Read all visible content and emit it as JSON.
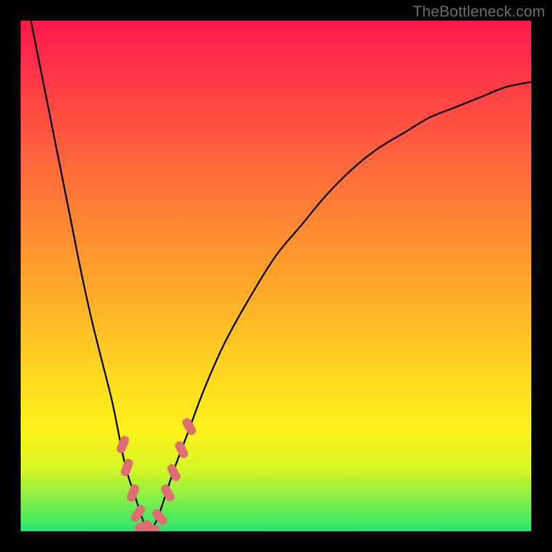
{
  "watermark": "TheBottleneck.com",
  "colors": {
    "frame": "#000000",
    "gradient_top": "#ff1a4b",
    "gradient_bottom": "#2be36e",
    "curve": "#000000",
    "marker_fill": "#de6e72",
    "marker_stroke": "#c85c63"
  },
  "chart_data": {
    "type": "line",
    "title": "",
    "xlabel": "",
    "ylabel": "",
    "xlim": [
      0,
      100
    ],
    "ylim": [
      0,
      100
    ],
    "grid": false,
    "series": [
      {
        "name": "curve",
        "x": [
          2,
          4,
          6,
          8,
          10,
          12,
          14,
          16,
          18,
          20,
          21,
          22,
          23,
          24,
          25,
          26,
          27,
          28,
          30,
          33,
          36,
          40,
          45,
          50,
          55,
          60,
          65,
          70,
          75,
          80,
          85,
          90,
          95,
          100
        ],
        "y": [
          100,
          90,
          80,
          70,
          60,
          50,
          41,
          33,
          25,
          15,
          11,
          8,
          5,
          2,
          0,
          1,
          3,
          6,
          12,
          20,
          28,
          37,
          46,
          54,
          60,
          66,
          71,
          75,
          78,
          81,
          83,
          85,
          87,
          88
        ]
      }
    ],
    "markers": [
      {
        "x": 20.0,
        "y": 17.0,
        "shape": "pill",
        "angle": -68
      },
      {
        "x": 20.8,
        "y": 12.5,
        "shape": "pill",
        "angle": -70
      },
      {
        "x": 22.0,
        "y": 7.5,
        "shape": "pill",
        "angle": -70
      },
      {
        "x": 23.0,
        "y": 3.5,
        "shape": "pill",
        "angle": -55
      },
      {
        "x": 24.0,
        "y": 1.0,
        "shape": "pill",
        "angle": -20
      },
      {
        "x": 25.5,
        "y": 0.5,
        "shape": "pill",
        "angle": 10
      },
      {
        "x": 27.2,
        "y": 2.8,
        "shape": "pill",
        "angle": 50
      },
      {
        "x": 28.8,
        "y": 7.5,
        "shape": "pill",
        "angle": 60
      },
      {
        "x": 30.0,
        "y": 11.5,
        "shape": "pill",
        "angle": 62
      },
      {
        "x": 31.5,
        "y": 16.0,
        "shape": "pill",
        "angle": 62
      },
      {
        "x": 33.0,
        "y": 20.5,
        "shape": "pill",
        "angle": 60
      }
    ]
  }
}
